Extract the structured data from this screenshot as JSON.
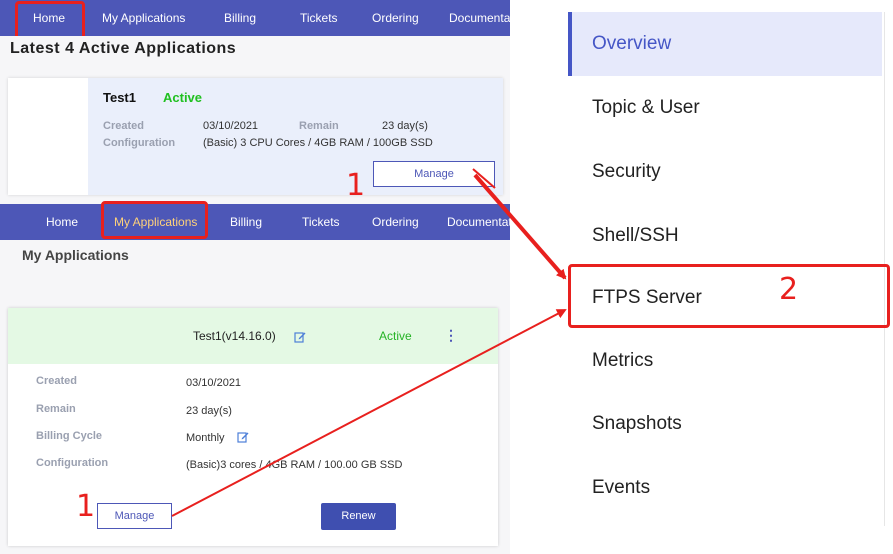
{
  "top_nav": {
    "items": [
      "Home",
      "My Applications",
      "Billing",
      "Tickets",
      "Ordering",
      "Documentation"
    ]
  },
  "latest": {
    "heading": "Latest 4 Active Applications",
    "app_name": "Test1",
    "status": "Active",
    "created_label": "Created",
    "created_value": "03/10/2021",
    "remain_label": "Remain",
    "remain_value": "23 day(s)",
    "config_label": "Configuration",
    "config_value": "(Basic) 3 CPU Cores / 4GB RAM / 100GB SSD",
    "manage_label": "Manage"
  },
  "mid_nav": {
    "items": [
      "Home",
      "My Applications",
      "Billing",
      "Tickets",
      "Ordering",
      "Documentation"
    ]
  },
  "my_apps": {
    "heading": "My Applications",
    "app_title": "Test1(v14.16.0)",
    "status": "Active",
    "kebab": "⋮",
    "rows": [
      {
        "label": "Created",
        "value": "03/10/2021"
      },
      {
        "label": "Remain",
        "value": "23 day(s)"
      },
      {
        "label": "Billing Cycle",
        "value": "Monthly"
      },
      {
        "label": "Configuration",
        "value": "(Basic)3 cores / 4GB RAM / 100.00 GB SSD"
      }
    ],
    "manage_label": "Manage",
    "renew_label": "Renew"
  },
  "sidebar": {
    "items": [
      "Overview",
      "Topic & User",
      "Security",
      "Shell/SSH",
      "FTPS Server",
      "Metrics",
      "Snapshots",
      "Events"
    ],
    "active": "Overview",
    "highlighted": "FTPS Server"
  },
  "markers": {
    "step1_top": "1",
    "step1_bottom": "1",
    "step2": "2"
  },
  "colors": {
    "nav_bg": "#4d57b7",
    "highlight_red": "#e8201e",
    "active_green": "#21c021",
    "sidebar_active_bg": "#e6e9fb",
    "sidebar_active_fg": "#4556c6"
  }
}
